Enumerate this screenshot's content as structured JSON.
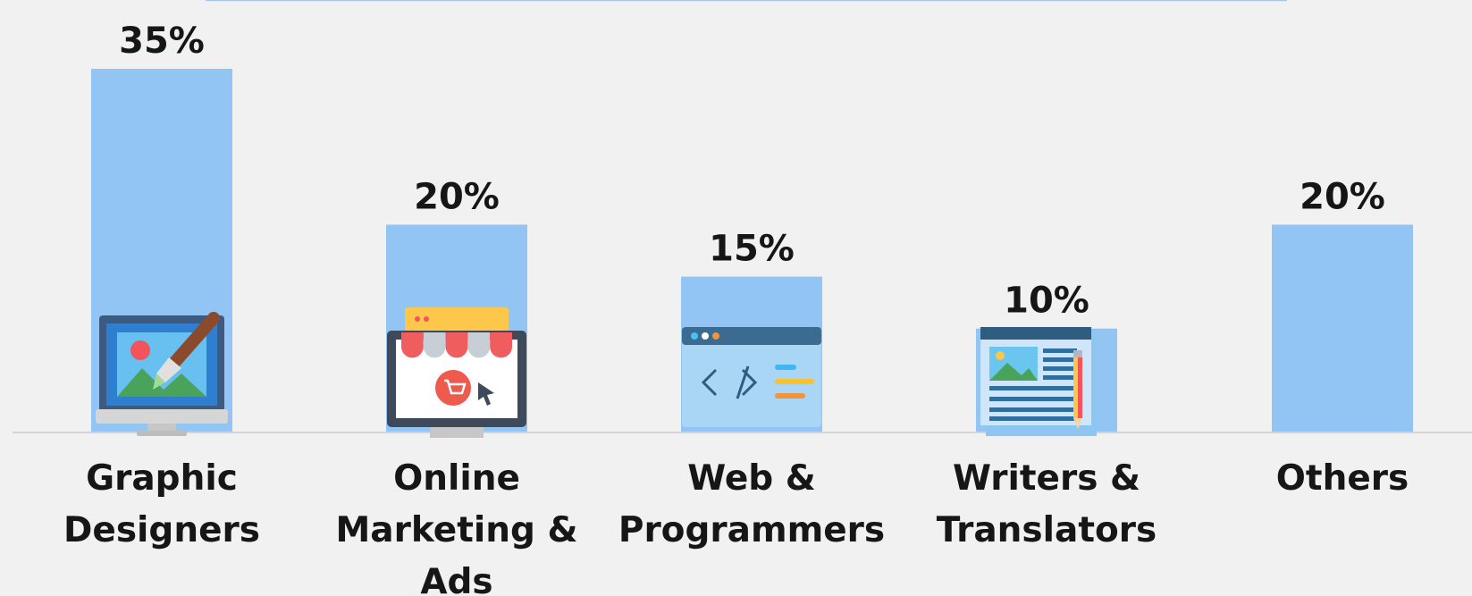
{
  "chart_data": {
    "type": "bar",
    "categories": [
      [
        "Graphic",
        "Designers"
      ],
      [
        "Online",
        "Marketing &",
        "Ads"
      ],
      [
        "Web &",
        "Programmers"
      ],
      [
        "Writers &",
        "Translators"
      ],
      [
        "Others"
      ]
    ],
    "values": [
      35,
      20,
      15,
      10,
      20
    ],
    "value_labels": [
      "35%",
      "20%",
      "15%",
      "10%",
      "20%"
    ],
    "icons": [
      "paintbrush-monitor-icon",
      "online-store-icon",
      "code-window-icon",
      "document-pencil-icon",
      null
    ],
    "ylim": [
      0,
      35
    ],
    "grid": false,
    "bar_color": "#93c5f4",
    "baseline_color": "#d4d4d4",
    "text_color": "#161616"
  }
}
